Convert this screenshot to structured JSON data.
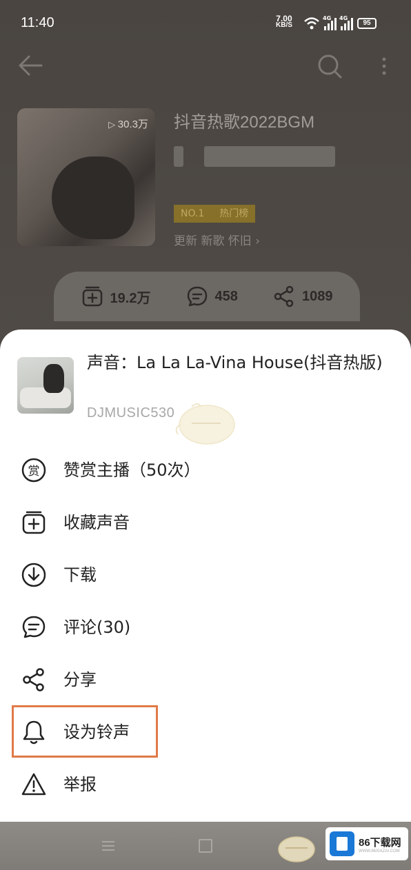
{
  "status_bar": {
    "time": "11:40",
    "net_speed_value": "7.00",
    "net_speed_unit": "KB/S",
    "signal1": "4G",
    "signal2": "4G",
    "battery": "95"
  },
  "album": {
    "title": "抖音热歌2022BGM",
    "play_count": "30.3万",
    "rank_badge": "NO.1",
    "rank_badge_suffix": "热门榜",
    "update_text": "更新 新歌 怀旧 ›"
  },
  "stats": {
    "subscribe_count": "19.2万",
    "comment_count": "458",
    "share_count": "1089"
  },
  "track": {
    "title": "声音：La La La-Vina House(抖音热版)",
    "author": "DJMUSIC530"
  },
  "menu": [
    {
      "label": "赞赏主播（50次）",
      "icon": "reward-icon"
    },
    {
      "label": "收藏声音",
      "icon": "collect-add-icon"
    },
    {
      "label": "下载",
      "icon": "download-icon"
    },
    {
      "label": "评论(30)",
      "icon": "comment-icon"
    },
    {
      "label": "分享",
      "icon": "share-icon"
    },
    {
      "label": "设为铃声",
      "icon": "bell-icon"
    },
    {
      "label": "举报",
      "icon": "warning-icon"
    }
  ],
  "highlighted_item": "设为铃声",
  "colors": {
    "highlight": "#e07a48",
    "watermark_blue": "#1a78d6"
  },
  "watermark": {
    "title": "86下载网",
    "url": "WWW.86XIAZAI.COM"
  }
}
